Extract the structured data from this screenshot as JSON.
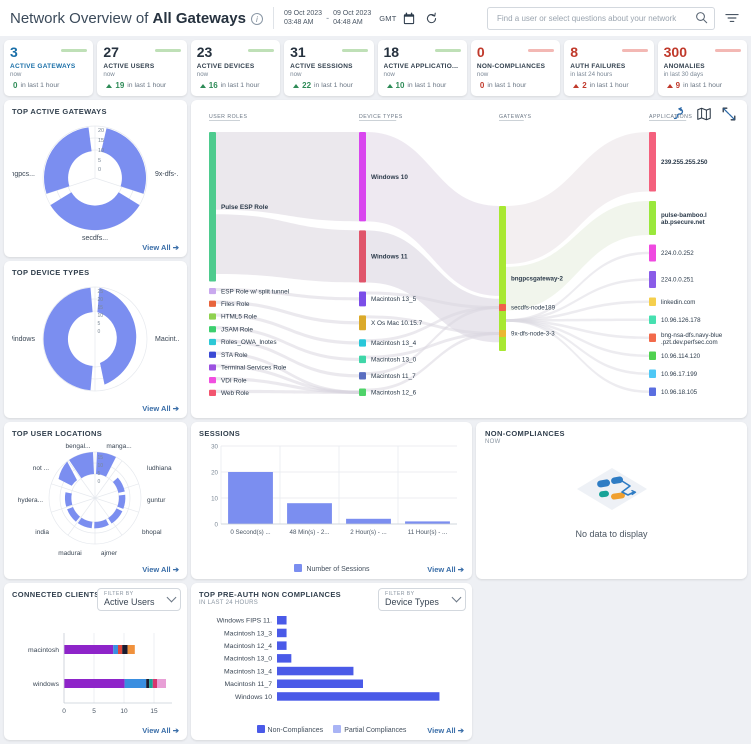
{
  "header": {
    "title_prefix": "Network Overview of ",
    "title_bold": "All Gateways",
    "info_icon": "info-icon",
    "date_start_date": "09 Oct 2023",
    "date_start_time": "03:48 AM",
    "date_dash": "-",
    "date_end_date": "09 Oct 2023",
    "date_end_time": "04:48 AM",
    "timezone": "GMT",
    "calendar_icon": "calendar-icon",
    "refresh_icon": "refresh-icon",
    "search_placeholder": "Find a user or select questions about your network",
    "search_value": "",
    "search_icon": "search-icon",
    "filter_icon": "filter-icon"
  },
  "kpis": [
    {
      "value": "3",
      "label": "ACTIVE GATEWAYS",
      "period": "now",
      "delta": "0",
      "delta_text": "in last 1 hour",
      "trend": "flat",
      "color": "#1a6fa8",
      "spark": "#bfe0b7"
    },
    {
      "value": "27",
      "label": "ACTIVE USERS",
      "period": "now",
      "delta": "19",
      "delta_text": "in last 1 hour",
      "trend": "up",
      "color": "#26323f",
      "spark": "#bfe0b7"
    },
    {
      "value": "23",
      "label": "ACTIVE DEVICES",
      "period": "now",
      "delta": "16",
      "delta_text": "in last 1 hour",
      "trend": "up",
      "color": "#26323f",
      "spark": "#bfe0b7"
    },
    {
      "value": "31",
      "label": "ACTIVE SESSIONS",
      "period": "now",
      "delta": "22",
      "delta_text": "in last 1 hour",
      "trend": "up",
      "color": "#26323f",
      "spark": "#bfe0b7"
    },
    {
      "value": "18",
      "label": "ACTIVE APPLICATIO...",
      "period": "now",
      "delta": "10",
      "delta_text": "in last 1 hour",
      "trend": "up",
      "color": "#26323f",
      "spark": "#bfe0b7"
    },
    {
      "value": "0",
      "label": "NON-COMPLIANCES",
      "period": "now",
      "delta": "0",
      "delta_text": "in last 1 hour",
      "trend": "flat-red",
      "color": "#c0392b",
      "spark": "#f3b8b4"
    },
    {
      "value": "8",
      "label": "AUTH FAILURES",
      "period": "in last 24 hours",
      "delta": "2",
      "delta_text": "in last 1 hour",
      "trend": "up-red",
      "color": "#c0392b",
      "spark": "#f3b8b4"
    },
    {
      "value": "300",
      "label": "ANOMALIES",
      "period": "in last 30 days",
      "delta": "9",
      "delta_text": "in last 1 hour",
      "trend": "up-red",
      "color": "#c0392b",
      "spark": "#f3b8b4"
    }
  ],
  "top_active_gateways": {
    "title": "TOP ACTIVE GATEWAYS",
    "view_all": "View All",
    "labels": [
      "bngpcs...",
      "9x-dfs-...",
      "secdfs..."
    ],
    "axis_ticks": [
      "0",
      "5",
      "10",
      "15",
      "20"
    ]
  },
  "top_device_types": {
    "title": "TOP DEVICE TYPES",
    "view_all": "View All",
    "labels": [
      "Windows",
      "Macint..."
    ],
    "axis_ticks": [
      "0",
      "5",
      "10",
      "15",
      "20",
      "25"
    ]
  },
  "top_user_locations": {
    "title": "TOP USER LOCATIONS",
    "view_all": "View All",
    "labels": [
      "bengal...",
      "manga...",
      "ludhiana",
      "guntur",
      "bhopal",
      "ajmer",
      "madurai",
      "india",
      "hydera...",
      "not ..."
    ],
    "axis_ticks": [
      "0",
      "5",
      "10",
      "15"
    ]
  },
  "sankey": {
    "columns": [
      "USER ROLES",
      "DEVICE TYPES",
      "GATEWAYS",
      "APPLICATIONS"
    ],
    "icons": [
      "sankey-view-icon",
      "map-view-icon",
      "fullscreen-icon"
    ],
    "user_roles": [
      {
        "name": "Pulse ESP Role",
        "color": "#4ECB8E",
        "value": 24
      },
      {
        "name": "ESP Role w/ split tunnel",
        "color": "#c9a8ee",
        "value": 1
      },
      {
        "name": "Files Role",
        "color": "#e8643c",
        "value": 1
      },
      {
        "name": "HTML5 Role",
        "color": "#8fd14f",
        "value": 1
      },
      {
        "name": "JSAM Role",
        "color": "#3dcf6e",
        "value": 1
      },
      {
        "name": "Roles_OWA_lnotes",
        "color": "#2ec8d6",
        "value": 1
      },
      {
        "name": "STA Role",
        "color": "#3a49d4",
        "value": 1
      },
      {
        "name": "Terminal Services Role",
        "color": "#9b51e0",
        "value": 1
      },
      {
        "name": "VDI Role",
        "color": "#f14ee0",
        "value": 1
      },
      {
        "name": "Web Role",
        "color": "#f2556f",
        "value": 1
      }
    ],
    "device_types": [
      {
        "name": "Windows 10",
        "color": "#d946ef",
        "value": 12
      },
      {
        "name": "Windows 11",
        "color": "#e0556b",
        "value": 7
      },
      {
        "name": "Macintosh 13_5",
        "color": "#7b4ee8",
        "value": 2
      },
      {
        "name": "X Os Mac 10.15.7",
        "color": "#dbaa2a",
        "value": 2
      },
      {
        "name": "Macintosh 13_4",
        "color": "#29c7d9",
        "value": 1
      },
      {
        "name": "Macintosh 13_0",
        "color": "#3fd6a8",
        "value": 1
      },
      {
        "name": "Macintosh 11_7",
        "color": "#5a6ec0",
        "value": 1
      },
      {
        "name": "Macintosh 12_6",
        "color": "#4fd36a",
        "value": 1
      }
    ],
    "gateways": [
      {
        "name": "bngpcsgateway-2",
        "color": "#a8e832",
        "value": 22
      },
      {
        "name": "secdfs-node189",
        "color": "#f0604a",
        "value": 1
      },
      {
        "name": "9x-dfs-node-3-3",
        "color": "#eab832",
        "value": 1
      }
    ],
    "applications": [
      {
        "name": "239.255.255.250",
        "color": "#f4607d",
        "value": 7
      },
      {
        "name": "pulse-bamboo.lab.psecure.net",
        "color": "#9ae83c",
        "value": 4
      },
      {
        "name": "224.0.0.252",
        "color": "#ef4ae0",
        "value": 2
      },
      {
        "name": "224.0.0.251",
        "color": "#8a5ce8",
        "value": 2
      },
      {
        "name": "linkedin.com",
        "color": "#f5cf4d",
        "value": 1
      },
      {
        "name": "10.96.126.178",
        "color": "#46e0b0",
        "value": 1
      },
      {
        "name": "bng-nsa-dfs.navy-blue.pzt.dev.perfsec.com",
        "color": "#f26a4b",
        "value": 1
      },
      {
        "name": "10.96.114.120",
        "color": "#4fd14f",
        "value": 1
      },
      {
        "name": "10.96.17.199",
        "color": "#4fc8f5",
        "value": 1
      },
      {
        "name": "10.96.18.105",
        "color": "#5a6ee0",
        "value": 1
      }
    ]
  },
  "sessions": {
    "title": "SESSIONS",
    "view_all": "View All",
    "legend_label": "Number of Sessions",
    "legend_color": "#7b8ef0"
  },
  "non_compliances_panel": {
    "title": "NON-COMPLIANCES",
    "subtitle": "NOW",
    "empty_text": "No data to display",
    "empty_icon": "no-data-icon"
  },
  "connected_clients": {
    "title": "CONNECTED CLIENTS",
    "view_all": "View All",
    "filter_label": "FILTER BY",
    "filter_value": "Active Users",
    "chevron_icon": "chevron-down-icon"
  },
  "pre_auth": {
    "title": "TOP PRE-AUTH NON COMPLIANCES",
    "subtitle": "IN LAST 24 HOURS",
    "view_all": "View All",
    "filter_label": "FILTER BY",
    "filter_value": "Device Types",
    "chevron_icon": "chevron-down-icon",
    "legend": [
      {
        "label": "Non-Compliances",
        "color": "#4a5ae8"
      },
      {
        "label": "Partial Compliances",
        "color": "#a9b4f5"
      }
    ]
  },
  "chart_data": [
    {
      "type": "bar",
      "id": "top-active-gateways-radial",
      "title": "TOP ACTIVE GATEWAYS",
      "categories": [
        "bngpcs...",
        "9x-dfs-...",
        "secdfs..."
      ],
      "values": [
        20,
        14,
        16
      ],
      "ylim": [
        0,
        20
      ],
      "ylabel": "",
      "grid": true,
      "legend": "none",
      "note": "radial (polar) bar chart"
    },
    {
      "type": "bar",
      "id": "top-device-types-radial",
      "title": "TOP DEVICE TYPES",
      "categories": [
        "Windows",
        "Macint..."
      ],
      "values": [
        25,
        22
      ],
      "ylim": [
        0,
        25
      ],
      "ylabel": "",
      "grid": true,
      "legend": "none",
      "note": "radial (polar) bar chart"
    },
    {
      "type": "bar",
      "id": "top-user-locations-radial",
      "title": "TOP USER LOCATIONS",
      "categories": [
        "bengal...",
        "manga...",
        "ludhiana",
        "guntur",
        "bhopal",
        "ajmer",
        "madurai",
        "india",
        "hydera...",
        "not ..."
      ],
      "values": [
        12,
        8,
        2,
        2,
        2,
        2,
        2,
        2,
        4,
        3
      ],
      "ylim": [
        0,
        15
      ],
      "ylabel": "",
      "grid": true,
      "legend": "none",
      "note": "radial (polar) bar chart"
    },
    {
      "type": "bar",
      "id": "sessions",
      "title": "SESSIONS",
      "categories": [
        "0 Second(s) ...",
        "48 Min(s) - 2...",
        "2 Hour(s) - ...",
        "11 Hour(s) - ..."
      ],
      "values": [
        20,
        8,
        2,
        1
      ],
      "series": [
        {
          "name": "Number of Sessions",
          "values": [
            20,
            8,
            2,
            1
          ]
        }
      ],
      "ylim": [
        0,
        30
      ],
      "yticks": [
        0,
        10,
        20,
        30
      ],
      "xlabel": "",
      "ylabel": "",
      "grid": true,
      "legend": "bottom"
    },
    {
      "type": "bar",
      "id": "connected-clients",
      "title": "CONNECTED CLIENTS",
      "orientation": "horizontal",
      "stacked": true,
      "categories": [
        "macintosh",
        "windows"
      ],
      "xlim": [
        0,
        18
      ],
      "xticks": [
        0,
        5,
        10,
        15
      ],
      "series": [
        {
          "name": "seg1",
          "color": "#8e24c9",
          "values": [
            8.2,
            10.1
          ]
        },
        {
          "name": "seg2",
          "color": "#3a8ee0",
          "values": [
            0.8,
            3.6
          ]
        },
        {
          "name": "seg3",
          "color": "#e0483c",
          "values": [
            0.7,
            0.0
          ]
        },
        {
          "name": "seg4",
          "color": "#1a1a2e",
          "values": [
            0.9,
            0.5
          ]
        },
        {
          "name": "seg5",
          "color": "#f0913c",
          "values": [
            1.2,
            0.0
          ]
        },
        {
          "name": "seg6",
          "color": "#17a398",
          "values": [
            0.0,
            0.6
          ]
        },
        {
          "name": "seg7",
          "color": "#d6366e",
          "values": [
            0.0,
            0.7
          ]
        },
        {
          "name": "seg8",
          "color": "#e89fd6",
          "values": [
            0.0,
            1.5
          ]
        }
      ],
      "grid": true,
      "legend": "none"
    },
    {
      "type": "bar",
      "id": "top-pre-auth-non-compliances",
      "title": "TOP PRE-AUTH NON COMPLIANCES",
      "orientation": "horizontal",
      "categories": [
        "Windows FIPS 11.",
        "Macintosh 13_3",
        "Macintosh 12_4",
        "Macintosh 13_0",
        "Macintosh 13_4",
        "Macintosh 11_7",
        "Windows 10"
      ],
      "values": [
        1,
        1,
        1,
        1.5,
        8,
        9,
        17
      ],
      "series": [
        {
          "name": "Non-Compliances",
          "color": "#4a5ae8",
          "values": [
            1,
            1,
            1,
            1.5,
            8,
            9,
            17
          ]
        },
        {
          "name": "Partial Compliances",
          "color": "#a9b4f5",
          "values": [
            0,
            0,
            0,
            0,
            0,
            0,
            0
          ]
        }
      ],
      "xlim": [
        0,
        18
      ],
      "grid": false,
      "legend": "bottom"
    },
    {
      "type": "sankey",
      "id": "network-sankey",
      "title": "",
      "columns": [
        "USER ROLES",
        "DEVICE TYPES",
        "GATEWAYS",
        "APPLICATIONS"
      ],
      "nodes": {
        "user_roles": [
          "Pulse ESP Role",
          "ESP Role w/ split tunnel",
          "Files Role",
          "HTML5 Role",
          "JSAM Role",
          "Roles_OWA_lnotes",
          "STA Role",
          "Terminal Services Role",
          "VDI Role",
          "Web Role"
        ],
        "device_types": [
          "Windows 10",
          "Windows 11",
          "Macintosh 13_5",
          "X Os Mac 10.15.7",
          "Macintosh 13_4",
          "Macintosh 13_0",
          "Macintosh 11_7",
          "Macintosh 12_6"
        ],
        "gateways": [
          "bngpcsgateway-2",
          "secdfs-node189",
          "9x-dfs-node-3-3"
        ],
        "applications": [
          "239.255.255.250",
          "pulse-bamboo.lab.psecure.net",
          "224.0.0.252",
          "224.0.0.251",
          "linkedin.com",
          "10.96.126.178",
          "bng-nsa-dfs.navy-blue.pzt.dev.perfsec.com",
          "10.96.114.120",
          "10.96.17.199",
          "10.96.18.105"
        ]
      }
    }
  ]
}
